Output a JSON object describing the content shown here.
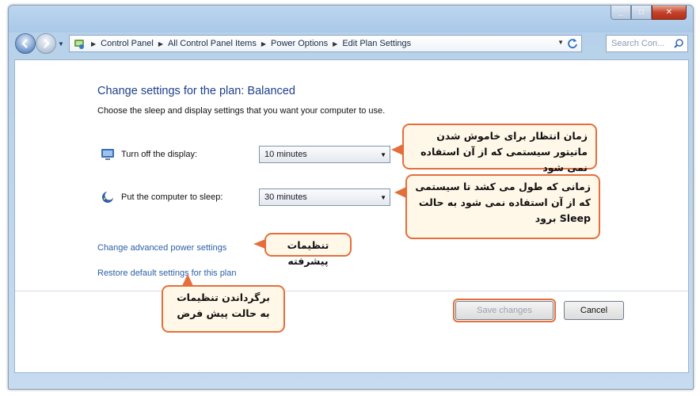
{
  "address_bar": {
    "breadcrumbs": [
      "Control Panel",
      "All Control Panel Items",
      "Power Options",
      "Edit Plan Settings"
    ],
    "search_placeholder": "Search Con..."
  },
  "main": {
    "heading": "Change settings for the plan: Balanced",
    "subtext": "Choose the sleep and display settings that you want your computer to use.",
    "settings": [
      {
        "label": "Turn off the display:",
        "value": "10 minutes",
        "icon": "monitor-icon"
      },
      {
        "label": "Put the computer to sleep:",
        "value": "30 minutes",
        "icon": "sleep-moon-icon"
      }
    ],
    "links": {
      "advanced": "Change advanced power settings",
      "restore": "Restore default settings for this plan"
    },
    "buttons": {
      "save": "Save changes",
      "cancel": "Cancel"
    }
  },
  "annotations": {
    "display_note": "زمان انتظار برای خاموش شدن مانیتور سیستمی که از آن استفاده نمی شود",
    "sleep_note_line1": "زمانی که طول می کشد تا سیستمی",
    "sleep_note_line2": "که از آن استفاده نمی شود به حالت",
    "sleep_note_line3": "Sleep برود",
    "advanced_note": "تنظیمات پیشرفته",
    "restore_note": "برگرداندن تنظیمات به حالت پیش فرض"
  },
  "colors": {
    "accent": "#e46f3c",
    "link": "#2c5fa8",
    "heading": "#1e3f8b"
  }
}
